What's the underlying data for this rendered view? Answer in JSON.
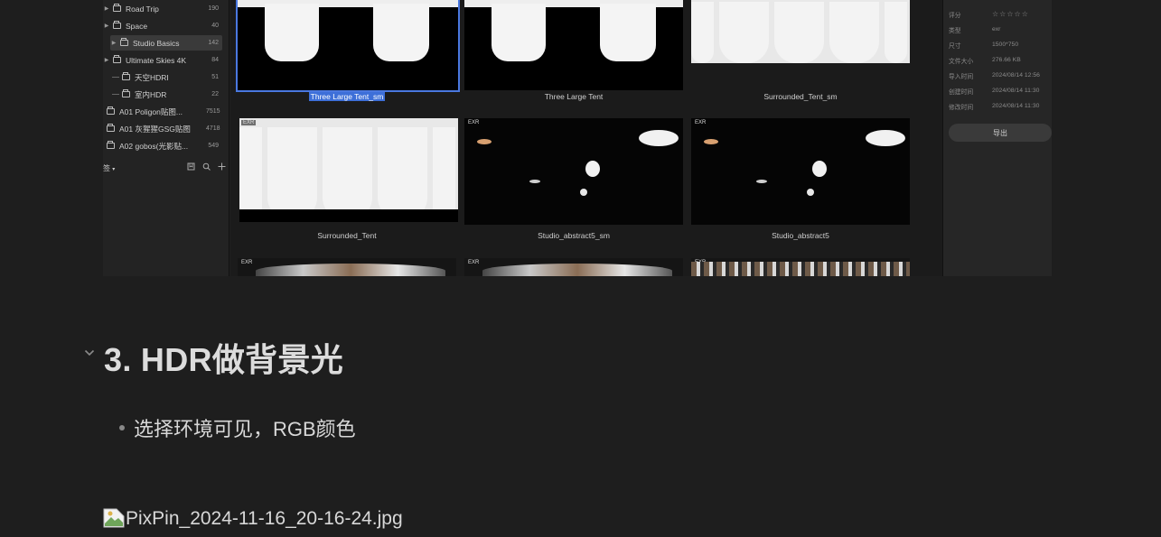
{
  "library": {
    "folders": [
      {
        "label": "Road Trip",
        "count": "190"
      },
      {
        "label": "Space",
        "count": "40"
      },
      {
        "label": "Studio Basics",
        "count": "142"
      },
      {
        "label": "Ultimate Skies 4K",
        "count": "84"
      },
      {
        "label": "天空HDRI",
        "count": "51"
      },
      {
        "label": "室内HDR",
        "count": "22"
      },
      {
        "label": "A01 Poligon贴图...",
        "count": "7515"
      },
      {
        "label": "A01 灰猩猩GSG贴图",
        "count": "4718"
      },
      {
        "label": "A02 gobos(光影贴...",
        "count": "549"
      }
    ],
    "footer_label": "签"
  },
  "thumbnails": {
    "badge": "EXR",
    "row1": [
      "Three Large Tent_sm",
      "Three Large Tent",
      "Surrounded_Tent_sm"
    ],
    "row2": [
      "Surrounded_Tent",
      "Studio_abstract5_sm",
      "Studio_abstract5"
    ]
  },
  "meta": {
    "rows": [
      {
        "key": "评分",
        "value": "☆☆☆☆☆"
      },
      {
        "key": "类型",
        "value": "exr"
      },
      {
        "key": "尺寸",
        "value": "1500*750"
      },
      {
        "key": "文件大小",
        "value": "276.66 KB"
      },
      {
        "key": "导入时间",
        "value": "2024/08/14 12:56"
      },
      {
        "key": "创建时间",
        "value": "2024/08/14 11:30"
      },
      {
        "key": "修改时间",
        "value": "2024/08/14 11:30"
      }
    ],
    "export_label": "导出"
  },
  "doc": {
    "heading": "3. HDR做背景光",
    "bullet": "选择环境可见，RGB颜色",
    "broken_image_alt": "PixPin_2024-11-16_20-16-24.jpg"
  }
}
